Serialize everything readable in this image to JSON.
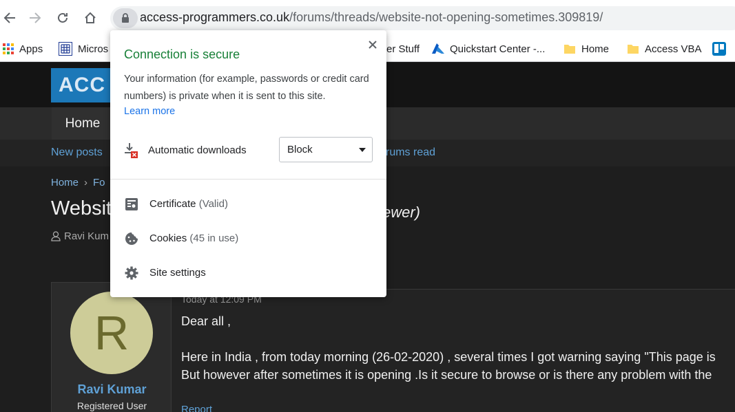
{
  "browser": {
    "url_host": "access-programmers.co.uk",
    "url_path": "/forums/threads/website-not-opening-sometimes.309819/",
    "bookmarks": [
      {
        "label": "Apps",
        "icon": "apps-grid-icon"
      },
      {
        "label": "Micros",
        "icon": "microsoft-icon"
      },
      {
        "label": "er Stuff",
        "icon": "folder-icon"
      },
      {
        "label": "Quickstart Center -...",
        "icon": "azure-icon"
      },
      {
        "label": "Home",
        "icon": "folder-icon"
      },
      {
        "label": "Access VBA",
        "icon": "folder-icon"
      },
      {
        "label": "",
        "icon": "trello-icon"
      }
    ]
  },
  "popup": {
    "title": "Connection is secure",
    "description": "Your information (for example, passwords or credit card numbers) is private when it is sent to this site.",
    "learn_more": "Learn more",
    "downloads_label": "Automatic downloads",
    "downloads_value": "Block",
    "certificate_label": "Certificate",
    "certificate_note": "(Valid)",
    "cookies_label": "Cookies",
    "cookies_note": "(45 in use)",
    "site_settings_label": "Site settings"
  },
  "forum": {
    "logo_text": "ACC",
    "nav_home": "Home",
    "new_posts": "New posts",
    "forums_read": "rums read",
    "breadcrumb_home": "Home",
    "breadcrumb_next": "Fo",
    "thread_title_start": "Websit",
    "thread_title_end": "ewer)",
    "starter_name": "Ravi Kum",
    "post": {
      "avatar_letter": "R",
      "username": "Ravi Kumar",
      "user_title": "Registered User",
      "date": "Today at 12:09 PM",
      "greeting": "Dear all ,",
      "line1": "Here in India , from today morning (26-02-2020) , several times I got warning saying \"This page is",
      "line2": "But however after sometimes it is opening .Is it secure to browse or is there any problem with the",
      "report": "Report"
    }
  },
  "colors": {
    "secure_green": "#188038",
    "link_blue": "#1a73e8",
    "forum_link": "#5fa1d6",
    "logo_blue": "#1c78b8"
  }
}
